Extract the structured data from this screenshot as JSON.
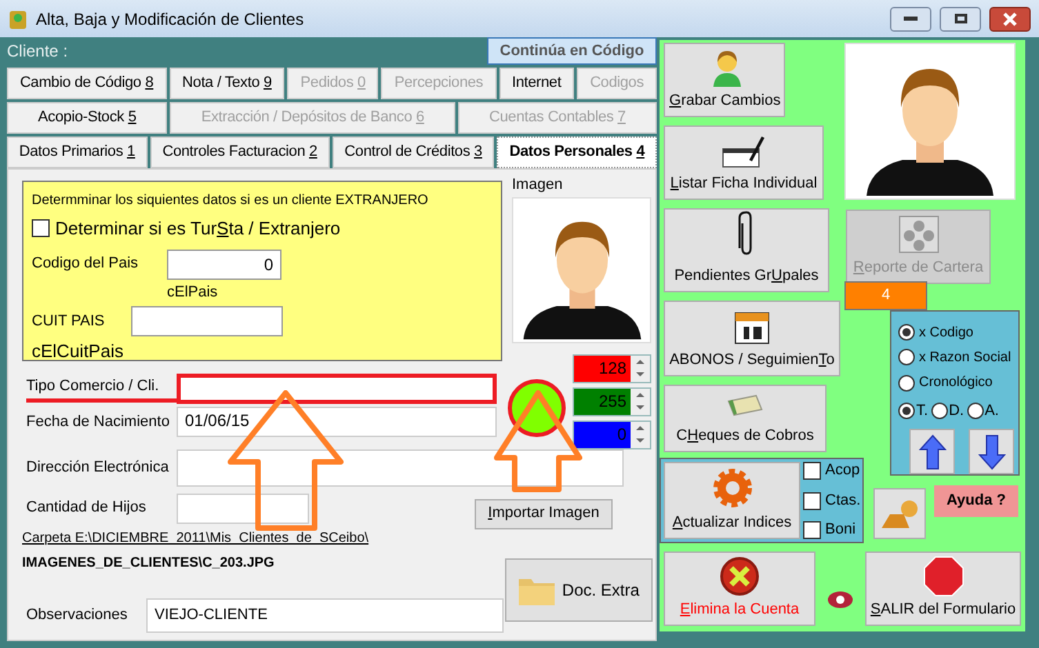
{
  "window": {
    "title": "Alta, Baja y Modificación de Clientes"
  },
  "client_bar": {
    "label": "Cliente :",
    "continue_button": "Continúa en Código"
  },
  "tab_rows": [
    [
      {
        "label": {
          "before": "Cambio de Código ",
          "hotkey": "8"
        },
        "disabled": false,
        "selected": false
      },
      {
        "label": {
          "before": "Nota / Texto ",
          "hotkey": "9"
        },
        "disabled": false,
        "selected": false
      },
      {
        "label": {
          "before": "Pedidos ",
          "hotkey": "0"
        },
        "disabled": true,
        "selected": false
      },
      {
        "label": {
          "before": "Percepciones"
        },
        "disabled": true,
        "selected": false
      },
      {
        "label": {
          "before": "Internet"
        },
        "disabled": false,
        "selected": false
      },
      {
        "label": {
          "before": "Codigos"
        },
        "disabled": true,
        "selected": false
      }
    ],
    [
      {
        "label": {
          "before": "Acopio-Stock ",
          "hotkey": "5"
        },
        "disabled": false,
        "selected": false
      },
      {
        "label": {
          "before": "Extracción / Depósitos de Banco ",
          "hotkey": "6"
        },
        "disabled": true,
        "selected": false
      },
      {
        "label": {
          "before": "Cuentas Contables ",
          "hotkey": "7"
        },
        "disabled": true,
        "selected": false
      }
    ],
    [
      {
        "label": {
          "before": "Datos Primarios ",
          "hotkey": "1"
        },
        "disabled": false,
        "selected": false
      },
      {
        "label": {
          "before": "Controles Facturacion ",
          "hotkey": "2"
        },
        "disabled": false,
        "selected": false
      },
      {
        "label": {
          "before": "Control de Créditos ",
          "hotkey": "3"
        },
        "disabled": false,
        "selected": false
      },
      {
        "label": {
          "before": "Datos Personales ",
          "hotkey": "4"
        },
        "disabled": false,
        "selected": true
      }
    ]
  ],
  "foreign": {
    "heading": "Determminar los siquientes datos si es un cliente EXTRANJERO",
    "checkbox": {
      "label": {
        "before": "Determinar si es Tur",
        "hotkey": "S",
        "after": "ta / Extranjero"
      },
      "checked": false
    },
    "country_code": {
      "label": "Codigo del Pais",
      "value": "0",
      "caption": "cElPais"
    },
    "cuit": {
      "label": "CUIT PAIS",
      "caption": "cElCuitPais"
    }
  },
  "image": {
    "label": "Imagen"
  },
  "color_spinners": [
    {
      "value": "128",
      "color": "#ff0000"
    },
    {
      "value": "255",
      "color": "#008000"
    },
    {
      "value": "0",
      "color": "#0000ff"
    }
  ],
  "color_swatch": {
    "color": "#80ff00"
  },
  "fields": [
    {
      "label": "Tipo Comercio / Cli."
    },
    {
      "label": "Fecha de Nacimiento",
      "value": "01/06/15"
    },
    {
      "label": "Dirección Electrónica"
    },
    {
      "label": "Cantidad de Hijos"
    }
  ],
  "import_button": {
    "hotkey": "I",
    "after": "mportar Imagen"
  },
  "folder": {
    "path": "Carpeta E:\\DICIEMBRE_2011\\Mis_Clientes_de_SCeibo\\",
    "file": "IMAGENES_DE_CLIENTES\\C_203.JPG"
  },
  "observations": {
    "label": "Observaciones",
    "value": "VIEJO-CLIENTE"
  },
  "doc_button": "Doc. Extra",
  "actions": {
    "save": {
      "hotkey": "G",
      "after": "rabar Cambios"
    },
    "print": {
      "hotkey": "L",
      "after": "istar Ficha Individual"
    },
    "pending": {
      "before": "Pendientes Gr",
      "hotkey": "U",
      "after": "pales"
    },
    "report": {
      "label": {
        "hotkey": "R",
        "after": "eporte de Cartera"
      },
      "disabled": true,
      "count": "4"
    },
    "payments": {
      "before": "ABONOS / Seguimien",
      "hotkey": "T",
      "after": "o"
    },
    "checks": {
      "before": "C",
      "hotkey": "H",
      "after": "eques de Cobros"
    },
    "reindex": {
      "hotkey": "A",
      "after": "ctualizar Indices"
    },
    "delete": {
      "hotkey": "E",
      "after": "limina la Cuenta"
    },
    "exit": {
      "hotkey": "S",
      "after": "ALIR del Formulario"
    }
  },
  "sort_options": [
    {
      "label": "x Codigo",
      "selected": true
    },
    {
      "label": "x Razon Social",
      "selected": false
    },
    {
      "label": "Cronológico",
      "selected": false
    }
  ],
  "range_options": [
    {
      "label": "T.",
      "selected": true
    },
    {
      "label": "D.",
      "selected": false
    },
    {
      "label": "A.",
      "selected": false
    }
  ],
  "index_checks": [
    {
      "label": "Acop",
      "checked": false
    },
    {
      "label": "Ctas.",
      "checked": false
    },
    {
      "label": "Boni",
      "checked": false
    }
  ],
  "help_button": "Ayuda ?"
}
